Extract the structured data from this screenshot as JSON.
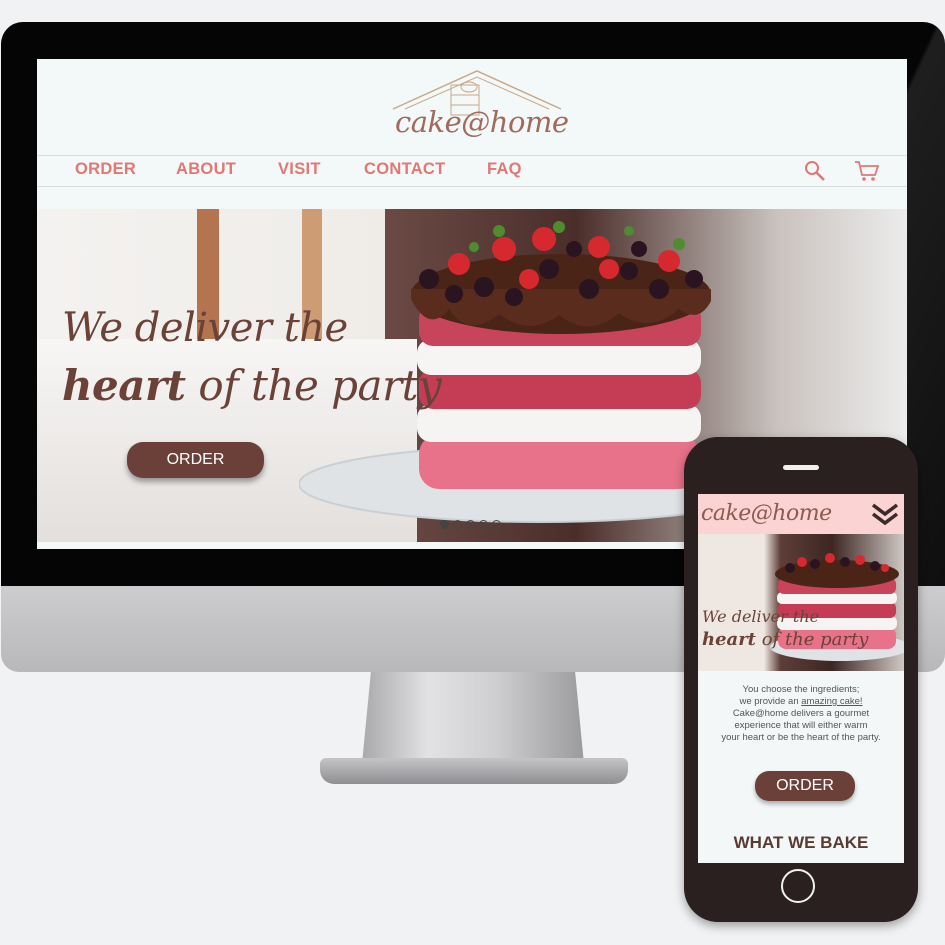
{
  "desktop": {
    "logo": "cake@home",
    "nav": [
      "ORDER",
      "ABOUT",
      "VISIT",
      "CONTACT",
      "FAQ"
    ],
    "icons": [
      "search-icon",
      "cart-icon"
    ],
    "hero": {
      "line1": "We deliver the",
      "line2_bold": "heart",
      "line2_rest": " of the party",
      "button": "ORDER"
    },
    "carousel_dots": 5,
    "carousel_active": 0
  },
  "mobile": {
    "logo": "cake@home",
    "menu_icon": "double-chevron-down-icon",
    "hero": {
      "line1": "We deliver the",
      "line2_bold": "heart",
      "line2_rest": " of the party"
    },
    "intro": {
      "line1": "You choose the ingredients;",
      "line2_pre": "we provide an ",
      "line2_link": "amazing cake!",
      "line3": "Cake@home delivers a gourmet",
      "line4": "experience that will either warm",
      "line5": "your heart or be the heart of the party."
    },
    "button": "ORDER",
    "section_title": "WHAT WE BAKE"
  },
  "colors": {
    "accent": "#e07874",
    "brown": "#6b4038",
    "pink_header": "#fbd3d2"
  }
}
